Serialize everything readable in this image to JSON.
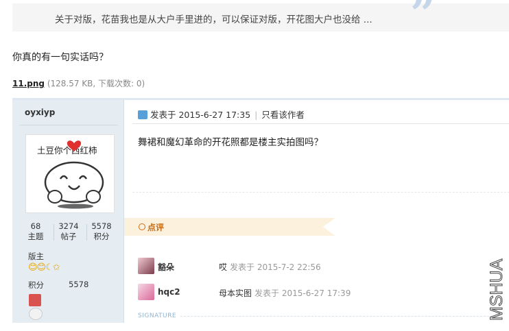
{
  "quote": {
    "text": "关于对版，花苗我也是从大户手里进的，可以保证对版，开花图大户也没给 ...",
    "mark": "”"
  },
  "reply": {
    "text": "你真的有一句实话吗？"
  },
  "attachment": {
    "filename": "11.png",
    "meta": "(128.57 KB, 下载次数: 0)"
  },
  "screenshot": {
    "author": {
      "username": "oyxiyp",
      "avatar_caption": "土豆你个西红柿",
      "stats": [
        {
          "value": "68",
          "label": "主题"
        },
        {
          "value": "3274",
          "label": "帖子"
        },
        {
          "value": "5578",
          "label": "积分"
        }
      ],
      "role": "版主",
      "points_label": "积分",
      "points_value": "5578",
      "rank_icons": "😊😊☾✩"
    },
    "post": {
      "posted_label": "发表于 2015-6-27 17:35",
      "only_author_label": "只看该作者",
      "divider": "|",
      "body": "舞裙和魔幻革命的开花照都是楼主实拍图吗？"
    },
    "review_label": "点评",
    "comments": [
      {
        "user": "豁朵",
        "text": "哎",
        "time": "发表于 2015-7-2 22:56"
      },
      {
        "user": "hqc2",
        "text": "母本实图",
        "time": "发表于 2015-6-27 17:39"
      }
    ],
    "signature_label": "SIGNATURE"
  },
  "watermark": {
    "text": "MSHUA"
  },
  "colors": {
    "quote_mark": "#c5d6ea",
    "sidebar_bg": "#e5edf2",
    "review_bg": "#fbf1dd",
    "review_text": "#c76b12"
  }
}
